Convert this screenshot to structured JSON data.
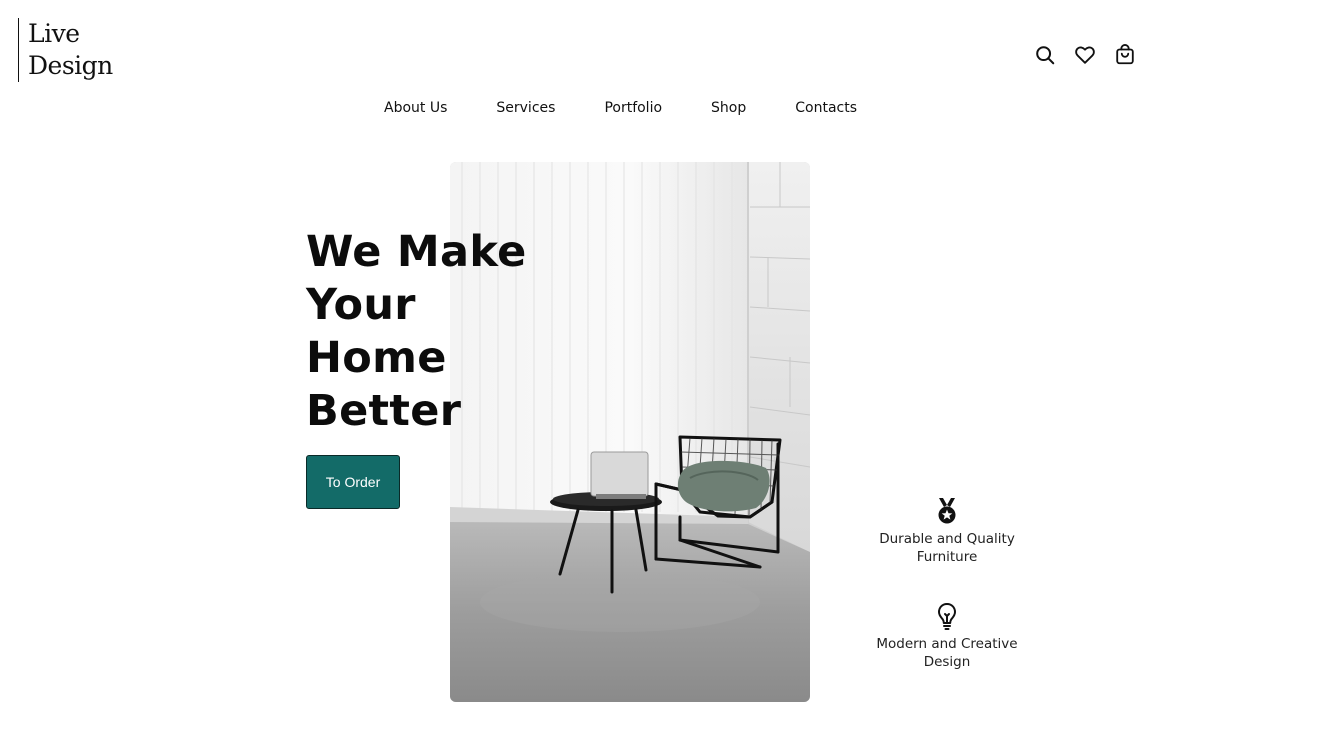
{
  "brand": {
    "line1": "Live",
    "line2": "Design"
  },
  "header": {
    "icons": [
      "search-icon",
      "heart-icon",
      "shopping-bag-icon"
    ]
  },
  "nav": {
    "items": [
      {
        "label": "About Us"
      },
      {
        "label": "Services"
      },
      {
        "label": "Portfolio"
      },
      {
        "label": "Shop"
      },
      {
        "label": "Contacts"
      }
    ]
  },
  "hero": {
    "title_lines": [
      "We Make",
      "Your",
      "Home",
      "Better"
    ],
    "cta_label": "To Order",
    "image_icon": "chair-room-photo"
  },
  "features": [
    {
      "icon": "medal-icon",
      "label_line1": "Durable and Quality",
      "label_line2": "Furniture"
    },
    {
      "icon": "lightbulb-icon",
      "label_line1": "Modern and Creative",
      "label_line2": "Design"
    }
  ],
  "colors": {
    "accent": "#136b68",
    "text": "#111111",
    "background": "#ffffff"
  }
}
